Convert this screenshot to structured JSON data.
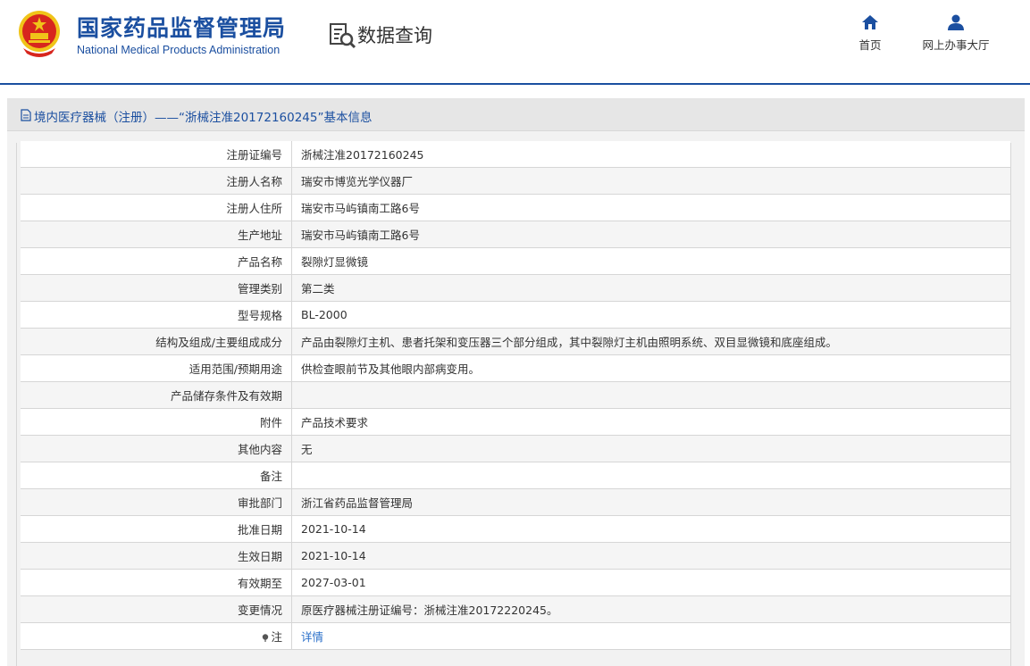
{
  "header": {
    "agency_cn": "国家药品监督管理局",
    "agency_en": "National Medical Products Administration",
    "section_title": "数据查询",
    "nav": [
      {
        "label": "首页",
        "icon": "home-icon"
      },
      {
        "label": "网上办事大厅",
        "icon": "user-icon"
      }
    ]
  },
  "panel": {
    "title": "境内医疗器械（注册）——“浙械注准20172160245”基本信息"
  },
  "rows": [
    {
      "label": "注册证编号",
      "value": "浙械注准20172160245"
    },
    {
      "label": "注册人名称",
      "value": "瑞安市博览光学仪器厂"
    },
    {
      "label": "注册人住所",
      "value": "瑞安市马屿镇南工路6号"
    },
    {
      "label": "生产地址",
      "value": "瑞安市马屿镇南工路6号"
    },
    {
      "label": "产品名称",
      "value": "裂隙灯显微镜"
    },
    {
      "label": "管理类别",
      "value": "第二类"
    },
    {
      "label": "型号规格",
      "value": "BL-2000"
    },
    {
      "label": "结构及组成/主要组成成分",
      "value": "产品由裂隙灯主机、患者托架和变压器三个部分组成，其中裂隙灯主机由照明系统、双目显微镜和底座组成。"
    },
    {
      "label": "适用范围/预期用途",
      "value": "供检查眼前节及其他眼内部病变用。"
    },
    {
      "label": "产品储存条件及有效期",
      "value": ""
    },
    {
      "label": "附件",
      "value": "产品技术要求"
    },
    {
      "label": "其他内容",
      "value": "无"
    },
    {
      "label": "备注",
      "value": ""
    },
    {
      "label": "审批部门",
      "value": "浙江省药品监督管理局"
    },
    {
      "label": "批准日期",
      "value": "2021-10-14"
    },
    {
      "label": "生效日期",
      "value": "2021-10-14"
    },
    {
      "label": "有效期至",
      "value": "2027-03-01"
    },
    {
      "label": "变更情况",
      "value": "原医疗器械注册证编号：浙械注准20172220245。"
    },
    {
      "label": "注",
      "value": "详情",
      "link": true
    }
  ],
  "colors": {
    "brand_blue": "#1b4fa0",
    "link_blue": "#2a6fc9",
    "emblem_red": "#d7261e",
    "emblem_gold": "#f0c419"
  }
}
